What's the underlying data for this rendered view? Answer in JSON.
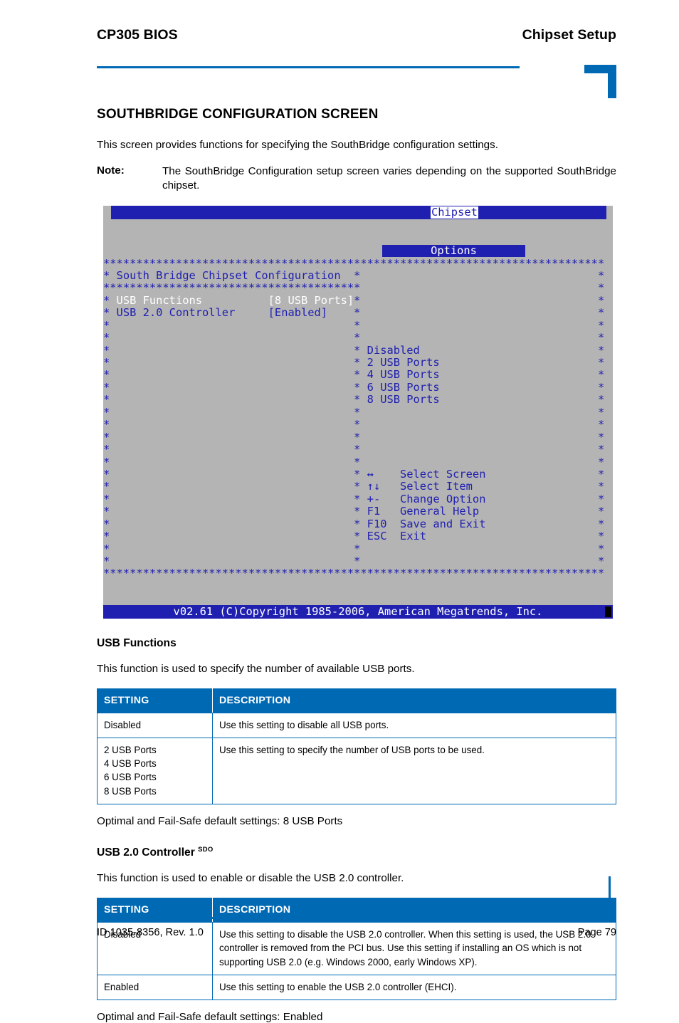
{
  "header": {
    "left_title": "CP305 BIOS",
    "right_title": "Chipset Setup"
  },
  "main": {
    "section_title": "SOUTHBRIDGE CONFIGURATION SCREEN",
    "intro": "This screen provides functions for specifying the SouthBridge configuration settings.",
    "note_label": "Note:",
    "note_text": "The SouthBridge Configuration setup screen varies depending on the supported SouthBridge chipset."
  },
  "bios": {
    "tab_label": "Chipset",
    "panel_title": "South Bridge Chipset Configuration",
    "options_header": "Options",
    "settings": [
      {
        "name": "USB Functions",
        "value": "[8 USB Ports]",
        "selected": true
      },
      {
        "name": "USB 2.0 Controller",
        "value": "[Enabled]",
        "selected": false
      }
    ],
    "option_list": [
      "Disabled",
      "2 USB Ports",
      "4 USB Ports",
      "6 USB Ports",
      "8 USB Ports"
    ],
    "help_keys": [
      {
        "key": "↔",
        "action": "Select Screen"
      },
      {
        "key": "↑↓",
        "action": "Select Item"
      },
      {
        "key": "+-",
        "action": "Change Option"
      },
      {
        "key": "F1",
        "action": "General Help"
      },
      {
        "key": "F10",
        "action": "Save and Exit"
      },
      {
        "key": "ESC",
        "action": "Exit"
      }
    ],
    "footer_bar": "v02.61 (C)Copyright 1985-2006, American Megatrends, Inc.",
    "colors": {
      "background": "#b4b4b4",
      "blue": "#2020b0",
      "white": "#ffffff"
    }
  },
  "sections": [
    {
      "title": "USB Functions",
      "title_sup": "",
      "description": "This function is used to specify the number of available USB ports.",
      "table": {
        "headers": [
          "SETTING",
          "DESCRIPTION"
        ],
        "rows": [
          {
            "setting": [
              "Disabled"
            ],
            "description": "Use this setting to disable all USB ports."
          },
          {
            "setting": [
              "2 USB Ports",
              "4 USB Ports",
              "6 USB Ports",
              "8 USB Ports"
            ],
            "description": "Use this setting to specify the number of USB ports to be used."
          }
        ]
      },
      "default_note": "Optimal and Fail-Safe default settings: 8 USB Ports"
    },
    {
      "title": "USB 2.0 Controller",
      "title_sup": "SDO",
      "description": "This function is used to enable or disable the USB 2.0 controller.",
      "table": {
        "headers": [
          "SETTING",
          "DESCRIPTION"
        ],
        "rows": [
          {
            "setting": [
              "Disabled"
            ],
            "description": "Use this setting to disable the USB 2.0 controller. When this setting is used, the USB 2.0 controller is removed from the PCI bus. Use this setting if installing an OS which is not supporting USB 2.0 (e.g. Windows 2000, early Windows XP)."
          },
          {
            "setting": [
              "Enabled"
            ],
            "description": "Use this setting to enable the USB 2.0 controller (EHCI)."
          }
        ]
      },
      "default_note": "Optimal and Fail-Safe default settings: Enabled"
    }
  ],
  "footer": {
    "left": "ID 1035-8356, Rev. 1.0",
    "right": "Page 79"
  },
  "accent_color": "#0069b4"
}
